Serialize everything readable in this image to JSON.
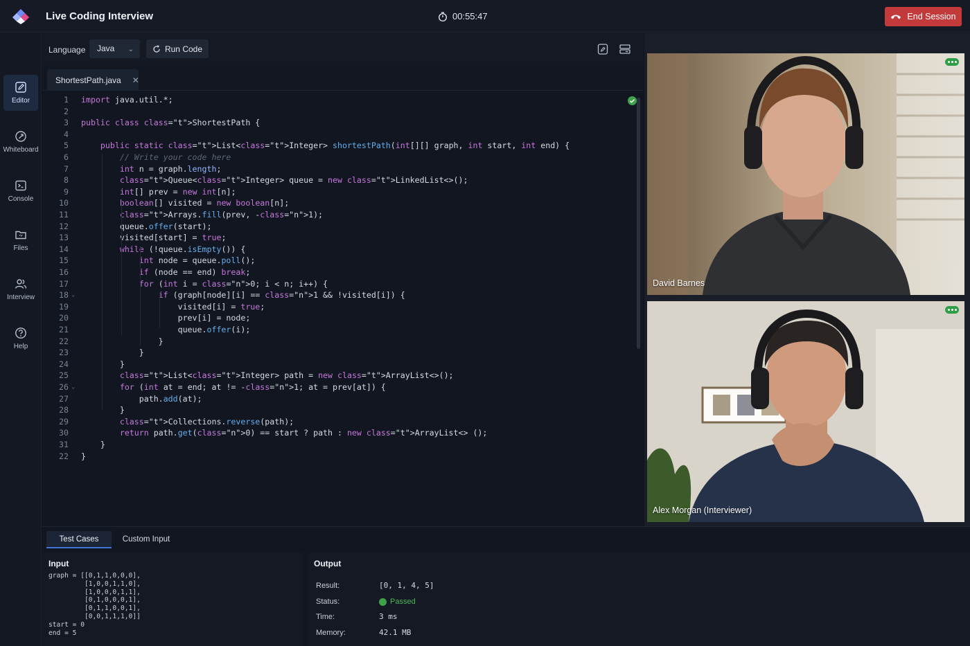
{
  "app": {
    "title": "Live Coding Interview",
    "timer": "00:55:47",
    "end_session_label": "End Session"
  },
  "nav": [
    {
      "label": "Editor",
      "icon": "edit-icon",
      "active": true
    },
    {
      "label": "Whiteboard",
      "icon": "whiteboard-icon"
    },
    {
      "label": "Console",
      "icon": "console-icon"
    },
    {
      "label": "Files",
      "icon": "folder-icon"
    },
    {
      "label": "Interview",
      "icon": "users-icon"
    },
    {
      "label": "Help",
      "icon": "help-icon"
    }
  ],
  "toolbar": {
    "language_label": "Language",
    "language_value": "Java",
    "run_label": "Run Code"
  },
  "file_tab": {
    "name": "ShortestPath.java"
  },
  "code": [
    {
      "n": "1",
      "t": "import java.util.*;"
    },
    {
      "n": "2",
      "t": ""
    },
    {
      "n": "3",
      "t": "public class ShortestPath {"
    },
    {
      "n": "4",
      "t": ""
    },
    {
      "n": "5",
      "t": "    public static List<Integer> shortestPath(int[][] graph, int start, int end) {"
    },
    {
      "n": "6",
      "t": "        // Write your code here"
    },
    {
      "n": "7",
      "t": "        int n = graph.length;"
    },
    {
      "n": "8",
      "t": "        Queue<Integer> queue = new LinkedList<>();"
    },
    {
      "n": "9",
      "t": "        int[] prev = new int[n];"
    },
    {
      "n": "10",
      "t": "        boolean[] visited = new boolean[n];"
    },
    {
      "n": "11",
      "t": "        Arrays.fill(prev, -1);"
    },
    {
      "n": "12",
      "t": "        queue.offer(start);"
    },
    {
      "n": "13",
      "t": "        visited[start] = true;"
    },
    {
      "n": "14",
      "t": "        while (!queue.isEmpty()) {"
    },
    {
      "n": "15",
      "t": "            int node = queue.poll();"
    },
    {
      "n": "16",
      "t": "            if (node == end) break;"
    },
    {
      "n": "17",
      "t": "            for (int i = 0; i < n; i++) {"
    },
    {
      "n": "18",
      "t": "                if (graph[node][i] == 1 && !visited[i]) {",
      "fold": true
    },
    {
      "n": "19",
      "t": "                    visited[i] = true;"
    },
    {
      "n": "20",
      "t": "                    prev[i] = node;"
    },
    {
      "n": "21",
      "t": "                    queue.offer(i);"
    },
    {
      "n": "22",
      "t": "                }"
    },
    {
      "n": "23",
      "t": "            }"
    },
    {
      "n": "24",
      "t": "        }"
    },
    {
      "n": "25",
      "t": "        List<Integer> path = new ArrayList<>();"
    },
    {
      "n": "26",
      "t": "        for (int at = end; at != -1; at = prev[at]) {",
      "fold": true
    },
    {
      "n": "27",
      "t": "            path.add(at);"
    },
    {
      "n": "28",
      "t": "        }"
    },
    {
      "n": "29",
      "t": "        Collections.reverse(path);"
    },
    {
      "n": "30",
      "t": "        return path.get(0) == start ? path : new ArrayList<> ();"
    },
    {
      "n": "31",
      "t": "    }"
    },
    {
      "n": "22",
      "t": "}"
    }
  ],
  "videos": [
    {
      "name": "David Barnes"
    },
    {
      "name": "Alex Morgan (Interviewer)"
    }
  ],
  "bottom_tabs": [
    "Test Cases",
    "Custom Input"
  ],
  "input": {
    "title": "Input",
    "text": "graph = [[0,1,1,0,0,0],\n         [1,0,0,1,1,0],\n         [1,0,0,0,1,1],\n         [0,1,0,0,0,1],\n         [0,1,1,0,0,1],\n         [0,0,1,1,1,0]]\nstart = 0\nend = 5"
  },
  "output": {
    "title": "Output",
    "rows": [
      {
        "key": "Result:",
        "value": "[0, 1, 4, 5]"
      },
      {
        "key": "Status:",
        "value": "Passed"
      },
      {
        "key": "Time:",
        "value": "3 ms"
      },
      {
        "key": "Memory:",
        "value": "42.1 MB"
      }
    ]
  },
  "colors": {
    "accent": "#3f74d8",
    "danger": "#c23a3a",
    "success": "#3fa24a"
  }
}
